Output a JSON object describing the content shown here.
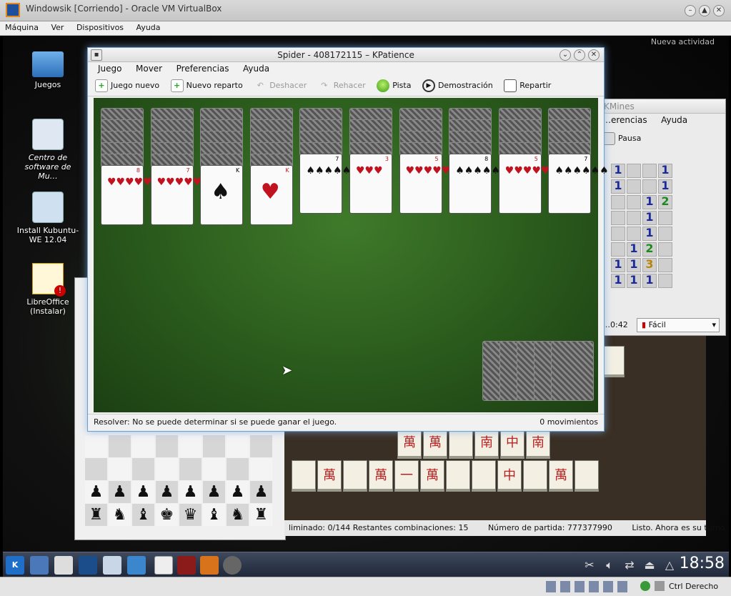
{
  "host": {
    "title": "Windowsik [Corriendo] - Oracle VM VirtualBox",
    "menu": [
      "Máquina",
      "Ver",
      "Dispositivos",
      "Ayuda"
    ],
    "status_key": "Ctrl Derecho"
  },
  "desktop": {
    "icons": [
      {
        "label": "Juegos",
        "icon": "folder-icon"
      },
      {
        "label": "Centro de software de Mu…",
        "icon": "software-center-icon"
      },
      {
        "label": "Install Kubuntu-WE 12.04",
        "icon": "install-icon"
      },
      {
        "label": "LibreOffice (Instalar)",
        "icon": "libreoffice-icon"
      }
    ],
    "notification": "Nueva actividad"
  },
  "kpatience": {
    "title": "Spider - 408172115 – KPatience",
    "menu": [
      "Juego",
      "Mover",
      "Preferencias",
      "Ayuda"
    ],
    "toolbar": [
      {
        "label": "Juego nuevo",
        "enabled": true,
        "icon": "new-game-icon"
      },
      {
        "label": "Nuevo reparto",
        "enabled": true,
        "icon": "new-deal-icon"
      },
      {
        "label": "Deshacer",
        "enabled": false,
        "icon": "undo-icon"
      },
      {
        "label": "Rehacer",
        "enabled": false,
        "icon": "redo-icon"
      },
      {
        "label": "Pista",
        "enabled": true,
        "icon": "hint-icon"
      },
      {
        "label": "Demostración",
        "enabled": true,
        "icon": "demo-icon"
      },
      {
        "label": "Repartir",
        "enabled": true,
        "icon": "deal-icon"
      }
    ],
    "tableau": [
      {
        "hidden": 5,
        "face": {
          "rank": "8",
          "suit": "hearts"
        }
      },
      {
        "hidden": 5,
        "face": {
          "rank": "7",
          "suit": "hearts"
        }
      },
      {
        "hidden": 5,
        "face": {
          "rank": "K",
          "suit": "spades"
        }
      },
      {
        "hidden": 5,
        "face": {
          "rank": "K",
          "suit": "hearts"
        }
      },
      {
        "hidden": 4,
        "face": {
          "rank": "7",
          "suit": "spades"
        }
      },
      {
        "hidden": 4,
        "face": {
          "rank": "3",
          "suit": "hearts"
        }
      },
      {
        "hidden": 4,
        "face": {
          "rank": "5",
          "suit": "hearts"
        }
      },
      {
        "hidden": 4,
        "face": {
          "rank": "8",
          "suit": "spades"
        }
      },
      {
        "hidden": 4,
        "face": {
          "rank": "5",
          "suit": "hearts"
        }
      },
      {
        "hidden": 4,
        "face": {
          "rank": "7",
          "suit": "spades"
        }
      }
    ],
    "stock_piles": 5,
    "status_left": "Resolver: No se puede determinar si se puede ganar el juego.",
    "status_right": "0 movimientos"
  },
  "kmines": {
    "title": "KMines",
    "menu": [
      "…erencias",
      "Ayuda"
    ],
    "pause_label": "Pausa",
    "time": "…0:42",
    "difficulty": "Fácil",
    "numbers": [
      {
        "v": "1",
        "c": 1
      },
      {
        "v": "1",
        "c": 1
      },
      {
        "v": "1",
        "c": 1
      },
      {
        "v": "1",
        "c": 1
      },
      {
        "v": "1",
        "c": 1
      },
      {
        "v": "2",
        "c": 2
      },
      {
        "v": "1",
        "c": 1
      },
      {
        "v": "1",
        "c": 1
      },
      {
        "v": "1",
        "c": 1
      },
      {
        "v": "2",
        "c": 2
      },
      {
        "v": "1",
        "c": 1
      },
      {
        "v": "1",
        "c": 1
      },
      {
        "v": "1",
        "c": 1
      },
      {
        "v": "3",
        "c": 3
      },
      {
        "v": "1",
        "c": 1
      },
      {
        "v": "1",
        "c": 1
      }
    ]
  },
  "mahjongg": {
    "status": "liminado: 0/144  Restantes combinaciones: 15",
    "game_number": "Número de partida: 777377990",
    "turn": "Listo. Ahora es su turno.",
    "tiles_row1": [
      "萬",
      "萬",
      "",
      "南",
      "中",
      "南"
    ],
    "tiles_row2": [
      "",
      "萬",
      "",
      "萬",
      "一",
      "萬",
      "",
      "",
      "中",
      "",
      "萬",
      ""
    ]
  },
  "chess": {
    "pawns": [
      "♟",
      "♟",
      "♟",
      "♟",
      "♟",
      "♟",
      "♟",
      "♟"
    ],
    "back_rank": [
      "♜",
      "♞",
      "♝",
      "♚",
      "♛",
      "♝",
      "♞",
      "♜"
    ]
  },
  "taskbar": {
    "clock": "18:58"
  }
}
